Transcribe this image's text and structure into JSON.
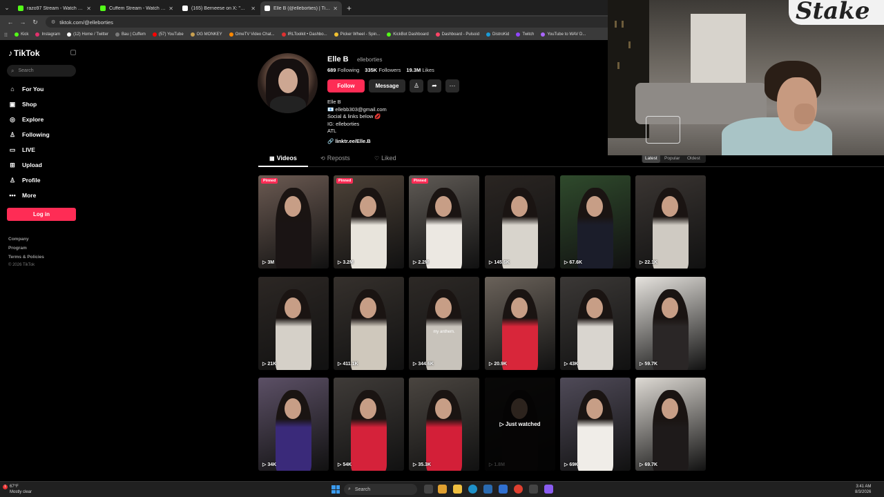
{
  "browser": {
    "tabs": [
      {
        "label": "razo97 Stream - Watch Live on",
        "favicon_color": "#53fc18",
        "active": false
      },
      {
        "label": "Cuffem Stream - Watch Live on",
        "favicon_color": "#53fc18",
        "active": false
      },
      {
        "label": "(165) Berneese on X: \"😂😂😂",
        "favicon_color": "#ffffff",
        "active": false
      },
      {
        "label": "Elle B (@elleborties) | TikTok",
        "favicon_color": "#ffffff",
        "active": true
      }
    ],
    "url": "tiktok.com/@elleborties",
    "bookmarks": [
      {
        "label": "Kick",
        "color": "#53fc18"
      },
      {
        "label": "Instagram",
        "color": "#e1306c"
      },
      {
        "label": "(12) Home / Twitter",
        "color": "#ffffff"
      },
      {
        "label": "Bau | Cuffem",
        "color": "#7a7a7a"
      },
      {
        "label": "(57) YouTube",
        "color": "#ff0000"
      },
      {
        "label": "OG MONKEY",
        "color": "#c8a050"
      },
      {
        "label": "OmeTV Video Chat...",
        "color": "#ff8800"
      },
      {
        "label": "IRLToolkit • Dashbo...",
        "color": "#e03030"
      },
      {
        "label": "Picker Wheel - Spin...",
        "color": "#f0c030"
      },
      {
        "label": "KickBot Dashboard",
        "color": "#53fc18"
      },
      {
        "label": "Dashboard - Pulsoid",
        "color": "#ff4466"
      },
      {
        "label": "DistroKid",
        "color": "#1a9bd7"
      },
      {
        "label": "Twitch",
        "color": "#9146ff"
      },
      {
        "label": "YouTube to WAV D...",
        "color": "#aa66ff"
      }
    ]
  },
  "sidebar": {
    "logo": "TikTok",
    "search_placeholder": "Search",
    "nav": [
      {
        "label": "For You",
        "icon": "home-icon",
        "glyph": "⌂"
      },
      {
        "label": "Shop",
        "icon": "shop-icon",
        "glyph": "▣"
      },
      {
        "label": "Explore",
        "icon": "compass-icon",
        "glyph": "◎"
      },
      {
        "label": "Following",
        "icon": "following-icon",
        "glyph": "♙"
      },
      {
        "label": "LIVE",
        "icon": "live-icon",
        "glyph": "▭"
      },
      {
        "label": "Upload",
        "icon": "upload-icon",
        "glyph": "⊞"
      },
      {
        "label": "Profile",
        "icon": "profile-icon",
        "glyph": "♙"
      },
      {
        "label": "More",
        "icon": "more-icon",
        "glyph": "•••"
      }
    ],
    "login_label": "Log in",
    "footer": [
      "Company",
      "Program",
      "Terms & Policies"
    ],
    "copyright": "© 2026 TikTok"
  },
  "profile": {
    "display_name": "Elle B",
    "handle": "elleborties",
    "stats": [
      {
        "value": "689",
        "label": "Following"
      },
      {
        "value": "335K",
        "label": "Followers"
      },
      {
        "value": "19.3M",
        "label": "Likes"
      }
    ],
    "follow_label": "Follow",
    "message_label": "Message",
    "bio_lines": [
      "Elle B",
      "📧 ellebb303@gmail.com",
      "Social & links below 💋",
      "IG: elleborties",
      "ATL"
    ],
    "link": "linktr.ee/Elle.B"
  },
  "content_tabs": [
    {
      "label": "Videos",
      "active": true
    },
    {
      "label": "Reposts",
      "active": false
    },
    {
      "label": "Liked",
      "active": false
    }
  ],
  "sort_options": [
    {
      "label": "Latest",
      "active": true
    },
    {
      "label": "Popular",
      "active": false
    },
    {
      "label": "Oldest",
      "active": false
    }
  ],
  "videos": [
    {
      "views": "3M",
      "pinned": "Pinned",
      "bg": "#6b5a52",
      "outfit": "#1a1414"
    },
    {
      "views": "3.2M",
      "pinned": "Pinned",
      "bg": "#4d4238",
      "outfit": "#e8e4dc"
    },
    {
      "views": "2.2M",
      "pinned": "Pinned",
      "bg": "#5f5a55",
      "outfit": "#ece8e2"
    },
    {
      "views": "145.6K",
      "bg": "#2a2522",
      "outfit": "#d8d4cc"
    },
    {
      "views": "67.6K",
      "bg": "#2f4a2c",
      "outfit": "#1b1d2a"
    },
    {
      "views": "22.1K",
      "bg": "#3a3532",
      "outfit": "#cfcac2"
    },
    {
      "views": "21K",
      "bg": "#2c2724",
      "outfit": "#d5d0c8"
    },
    {
      "views": "411.1K",
      "bg": "#35302c",
      "outfit": "#cfc8bc"
    },
    {
      "views": "344.6K",
      "bg": "#2d2926",
      "outfit": "#c8c3bb",
      "overlay": "my anthem."
    },
    {
      "views": "20.9K",
      "bg": "#6a625a",
      "outfit": "#d8263a"
    },
    {
      "views": "43K",
      "bg": "#3b3836",
      "outfit": "#d9d5cf"
    },
    {
      "views": "59.7K",
      "bg": "#e6e3de",
      "outfit": "#2a2626"
    },
    {
      "views": "34K",
      "bg": "#5c5066",
      "outfit": "#3a2a7a"
    },
    {
      "views": "54K",
      "bg": "#3f3b38",
      "outfit": "#d5223a"
    },
    {
      "views": "35.3K",
      "bg": "#4a4540",
      "outfit": "#d31f38"
    },
    {
      "views": "1.8M",
      "bg": "#2a2624",
      "outfit": "#1e1a1a",
      "watched": "Just watched"
    },
    {
      "views": "69K",
      "bg": "#4f4a58",
      "outfit": "#f0ede8"
    },
    {
      "views": "69.7K",
      "bg": "#dedad4",
      "outfit": "#1e1a1a"
    }
  ],
  "taskbar": {
    "weather_temp": "67°F",
    "weather_desc": "Mostly clear",
    "search_placeholder": "Search",
    "time": "3:41 AM",
    "date": "8/3/2026"
  }
}
